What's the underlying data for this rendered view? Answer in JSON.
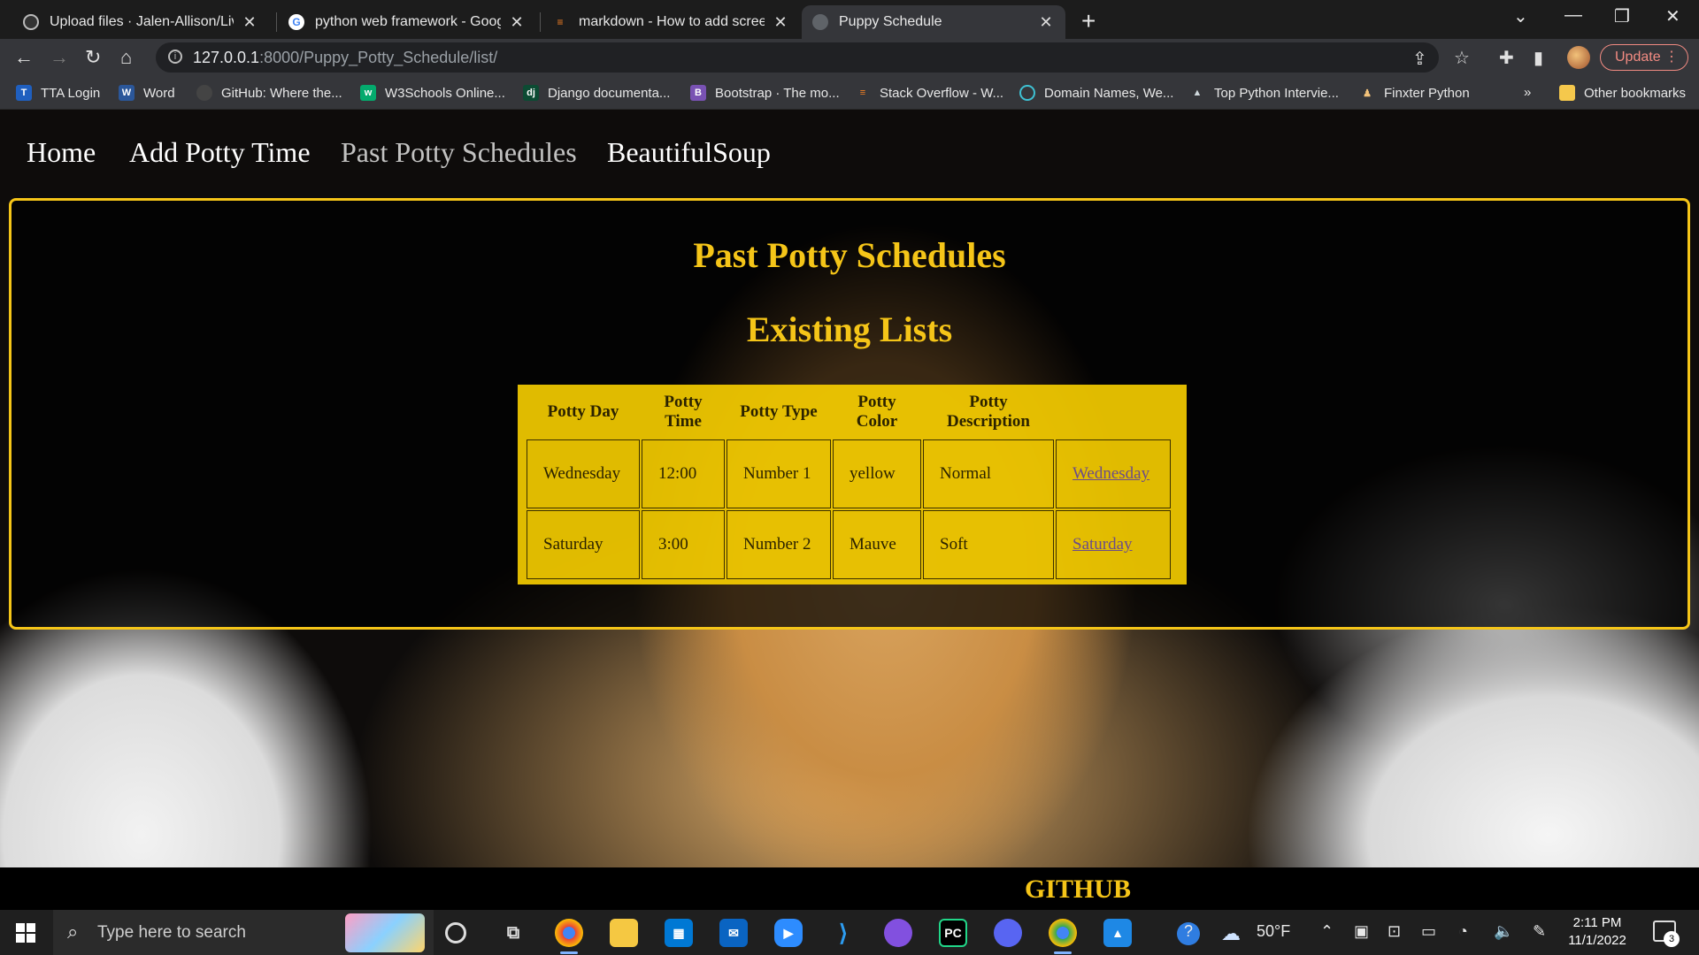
{
  "browser": {
    "tabs": [
      {
        "title": "Upload files · Jalen-Allison/Live-P",
        "icon": "github-icon"
      },
      {
        "title": "python web framework - Google",
        "icon": "google-icon"
      },
      {
        "title": "markdown - How to add screensh",
        "icon": "stackoverflow-icon"
      },
      {
        "title": "Puppy Schedule",
        "icon": "globe-icon"
      }
    ],
    "new_tab": "+",
    "url_host": "127.0.0.1",
    "url_rest": ":8000/Puppy_Potty_Schedule/list/",
    "update_label": "Update",
    "bookmarks": [
      {
        "label": "TTA Login"
      },
      {
        "label": "Word"
      },
      {
        "label": "GitHub: Where the..."
      },
      {
        "label": "W3Schools Online..."
      },
      {
        "label": "Django documenta..."
      },
      {
        "label": "Bootstrap · The mo..."
      },
      {
        "label": "Stack Overflow - W..."
      },
      {
        "label": "Domain Names, We..."
      },
      {
        "label": "Top Python Intervie..."
      },
      {
        "label": "Finxter Python"
      }
    ],
    "bookmarks_overflow": "»",
    "other_bookmarks": "Other bookmarks"
  },
  "site": {
    "nav": [
      "Home",
      "Add Potty Time",
      "Past Potty Schedules",
      "BeautifulSoup"
    ],
    "heading": "Past Potty Schedules",
    "subheading": "Existing Lists",
    "table": {
      "headers": [
        "Potty Day",
        "Potty Time",
        "Potty Type",
        "Potty Color",
        "Potty Description",
        ""
      ],
      "rows": [
        {
          "day": "Wednesday",
          "time": "12:00",
          "type": "Number 1",
          "color": "yellow",
          "description": "Normal",
          "link": "Wednesday"
        },
        {
          "day": "Saturday",
          "time": "3:00",
          "type": "Number 2",
          "color": "Mauve",
          "description": "Soft",
          "link": "Saturday"
        }
      ]
    },
    "footer_link": "GITHUB"
  },
  "taskbar": {
    "search_placeholder": "Type here to search",
    "weather": "50°F",
    "time": "2:11 PM",
    "date": "11/1/2022",
    "notifications": "3"
  },
  "colors": {
    "accent": "#f5c518",
    "table_bg": "#ffd500"
  }
}
